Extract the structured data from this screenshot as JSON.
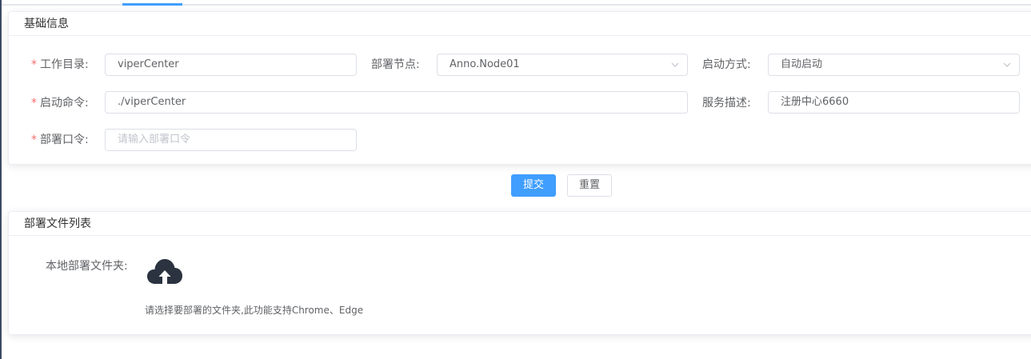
{
  "basic": {
    "title": "基础信息",
    "work_dir": {
      "label": "工作目录:",
      "value": "viperCenter"
    },
    "deploy_node": {
      "label": "部署节点:",
      "value": "Anno.Node01"
    },
    "start_mode": {
      "label": "启动方式:",
      "value": "自动启动"
    },
    "start_cmd": {
      "label": "启动命令:",
      "value": "./viperCenter"
    },
    "service_desc": {
      "label": "服务描述:",
      "value": "注册中心6660"
    },
    "deploy_password": {
      "label": "部署口令:",
      "placeholder": "请输入部署口令"
    },
    "required_mark": "*"
  },
  "actions": {
    "submit": "提交",
    "reset": "重置"
  },
  "files": {
    "title": "部署文件列表",
    "local_folder_label": "本地部署文件夹:",
    "tip": "请选择要部署的文件夹,此功能支持Chrome、Edge"
  },
  "colors": {
    "primary": "#409eff",
    "required": "#f56c6c",
    "icon": "#2b3340"
  }
}
